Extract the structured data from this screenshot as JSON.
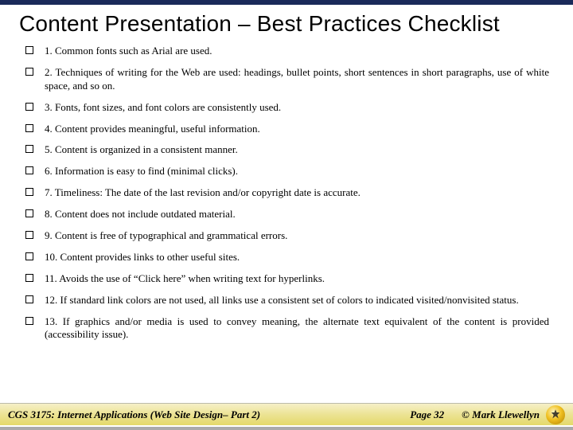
{
  "title": "Content Presentation – Best Practices Checklist",
  "items": [
    "1. Common fonts such as Arial are used.",
    "2. Techniques of writing for the Web are used: headings, bullet points, short sentences in short paragraphs, use of white space, and so on.",
    "3. Fonts, font sizes, and font colors are consistently used.",
    "4. Content provides meaningful, useful information.",
    "5. Content is organized in a consistent manner.",
    "6. Information is easy to find (minimal clicks).",
    "7. Timeliness: The date of the last revision and/or copyright date is accurate.",
    "8. Content does not include outdated material.",
    "9. Content is free of typographical and grammatical errors.",
    "10. Content provides links to other useful sites.",
    "11. Avoids the use of “Click here” when writing text for hyperlinks.",
    "12. If standard link colors are not used, all links use a consistent set of colors to indicated visited/nonvisited status.",
    "13. If graphics and/or media is used to convey meaning, the alternate text equivalent of the content is provided (accessibility issue)."
  ],
  "footer": {
    "course": "CGS 3175: Internet Applications (Web Site Design– Part 2)",
    "page": "Page 32",
    "copyright": "© Mark Llewellyn"
  }
}
